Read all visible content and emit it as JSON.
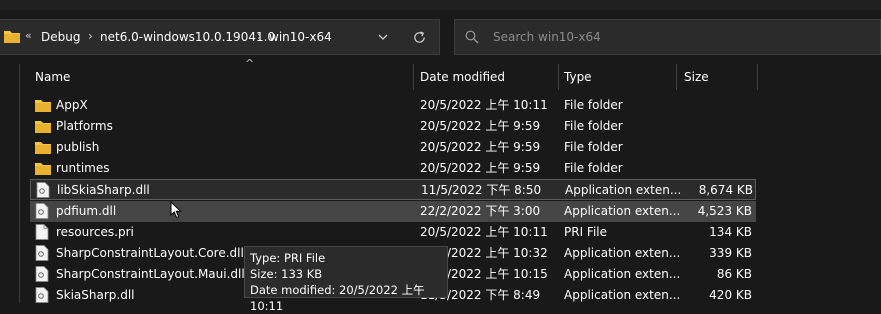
{
  "address": {
    "prefix_glyph": "«",
    "crumbs": [
      "Debug",
      "net6.0-windows10.0.19041.0",
      "win10-x64"
    ],
    "separator": "›"
  },
  "search": {
    "placeholder": "Search win10-x64"
  },
  "columns": {
    "name": "Name",
    "date": "Date modified",
    "type": "Type",
    "size": "Size"
  },
  "rows": [
    {
      "name": "AppX",
      "date": "20/5/2022 上午 10:11",
      "type": "File folder",
      "size": "",
      "icon": "folder-icon"
    },
    {
      "name": "Platforms",
      "date": "20/5/2022 上午 9:59",
      "type": "File folder",
      "size": "",
      "icon": "folder-icon"
    },
    {
      "name": "publish",
      "date": "20/5/2022 上午 9:59",
      "type": "File folder",
      "size": "",
      "icon": "folder-icon"
    },
    {
      "name": "runtimes",
      "date": "20/5/2022 上午 9:59",
      "type": "File folder",
      "size": "",
      "icon": "folder-icon"
    },
    {
      "name": "libSkiaSharp.dll",
      "date": "11/5/2022 下午 8:50",
      "type": "Application exten...",
      "size": "8,674 KB",
      "icon": "dll-file-icon"
    },
    {
      "name": "pdfium.dll",
      "date": "22/2/2022 下午 3:00",
      "type": "Application exten...",
      "size": "4,523 KB",
      "icon": "dll-file-icon"
    },
    {
      "name": "resources.pri",
      "date": "20/5/2022 上午 10:11",
      "type": "PRI File",
      "size": "134 KB",
      "icon": "document-file-icon"
    },
    {
      "name": "SharpConstraintLayout.Core.dll",
      "date": "11/5/2022 上午 10:32",
      "type": "Application exten...",
      "size": "339 KB",
      "icon": "dll-file-icon"
    },
    {
      "name": "SharpConstraintLayout.Maui.dll",
      "date": "14/5/2022 上午 10:15",
      "type": "Application exten...",
      "size": "86 KB",
      "icon": "dll-file-icon"
    },
    {
      "name": "SkiaSharp.dll",
      "date": "11/5/2022 下午 8:49",
      "type": "Application exten...",
      "size": "420 KB",
      "icon": "dll-file-icon"
    }
  ],
  "tooltip": {
    "line1": "Type: PRI File",
    "line2": "Size: 133 KB",
    "line3": "Date modified: 20/5/2022 上午 10:11"
  },
  "colors": {
    "background": "#191919",
    "folder": "#f4c542",
    "selected_border": "#5c5c5c",
    "hover": "#454545"
  }
}
